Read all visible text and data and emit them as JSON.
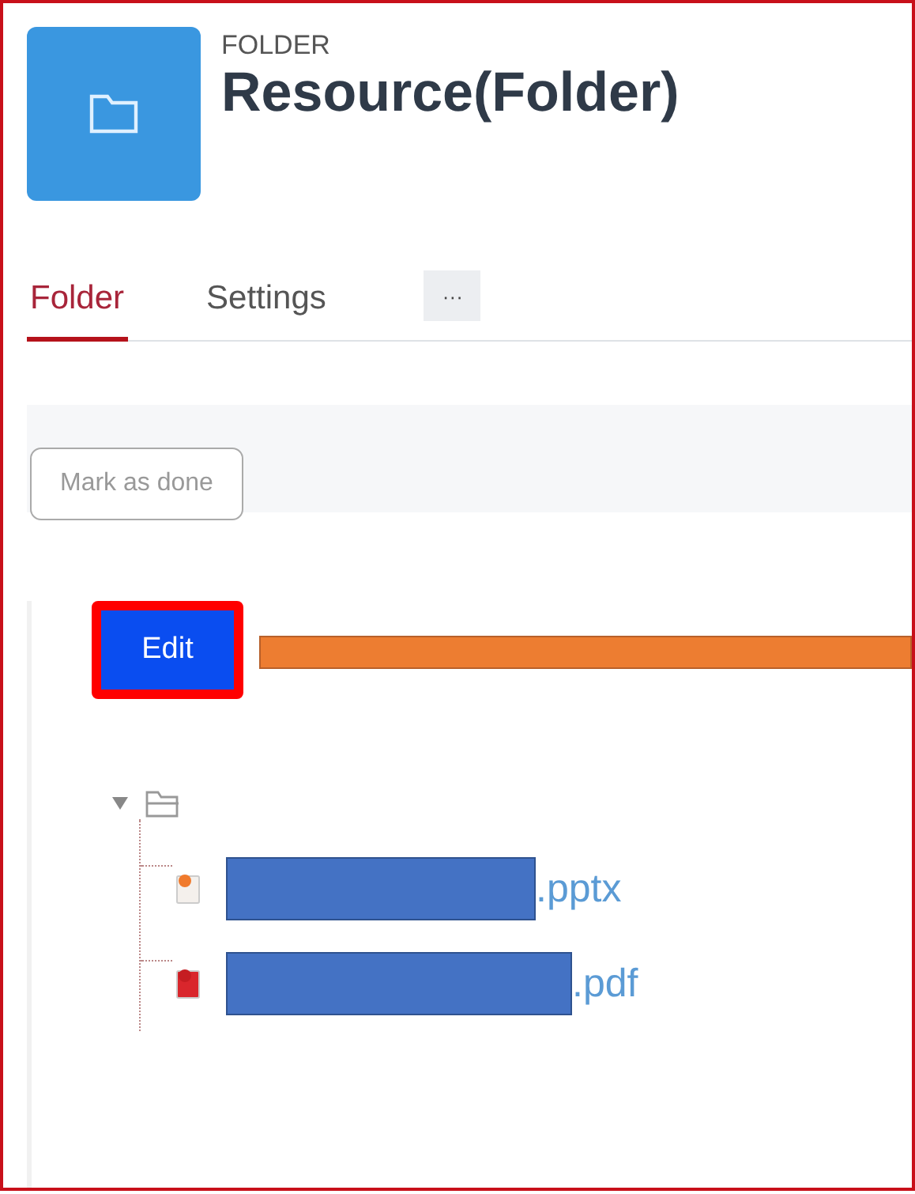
{
  "header": {
    "kind_label": "FOLDER",
    "title": "Resource(Folder)"
  },
  "tabs": [
    {
      "label": "Folder",
      "selected": true
    },
    {
      "label": "Settings",
      "selected": false
    }
  ],
  "more_button": {
    "label": "···"
  },
  "mark_done_button": {
    "label": "Mark as done"
  },
  "edit_button": {
    "label": "Edit"
  },
  "tree": {
    "expanded": true,
    "children": [
      {
        "kind": "pptx",
        "name": ".pptx"
      },
      {
        "kind": "pdf",
        "name": ".pdf"
      }
    ]
  }
}
